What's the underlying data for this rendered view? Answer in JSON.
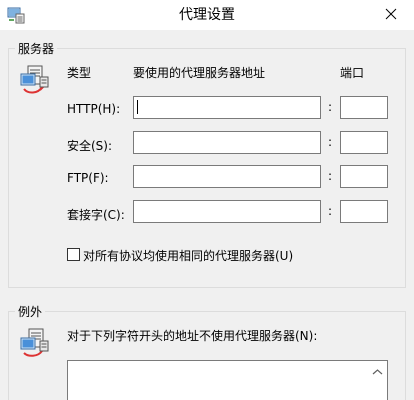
{
  "window": {
    "title": "代理设置"
  },
  "servers": {
    "legend": "服务器",
    "col_type": "类型",
    "col_address": "要使用的代理服务器地址",
    "col_port": "端口",
    "colon": ":",
    "rows": [
      {
        "label": "HTTP(H):",
        "address": "",
        "port": ""
      },
      {
        "label": "安全(S):",
        "address": "",
        "port": ""
      },
      {
        "label": "FTP(F):",
        "address": "",
        "port": ""
      },
      {
        "label": "套接字(C):",
        "address": "",
        "port": ""
      }
    ],
    "same_proxy_label": "对所有协议均使用相同的代理服务器(U)",
    "same_proxy_checked": false
  },
  "exceptions": {
    "legend": "例外",
    "description": "对于下列字符开头的地址不使用代理服务器(N):",
    "value": ""
  },
  "icons": {
    "app": "proxy-settings-icon",
    "close": "close-icon",
    "servers": "computer-network-icon",
    "exceptions": "document-computer-icon",
    "scroll": "chevron-up-icon"
  }
}
